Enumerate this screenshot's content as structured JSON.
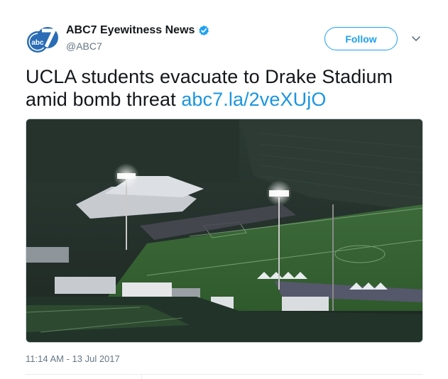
{
  "tweet": {
    "author": {
      "display_name": "ABC7 Eyewitness News",
      "handle": "@ABC7",
      "verified": true,
      "avatar_text": "abc",
      "avatar_number": "7"
    },
    "follow_label": "Follow",
    "text": "UCLA students evacuate to Drake Stadium amid bomb threat ",
    "link_text": "abc7.la/2veXUjO",
    "timestamp": "11:14 AM - 13 Jul 2017"
  },
  "colors": {
    "brand_blue": "#1da1f2",
    "link_blue": "#1b95e0",
    "secondary_text": "#657786",
    "avatar_blue": "#2a6cb5"
  },
  "icons": {
    "verified": "verified-badge-icon",
    "caret": "chevron-down-icon"
  }
}
